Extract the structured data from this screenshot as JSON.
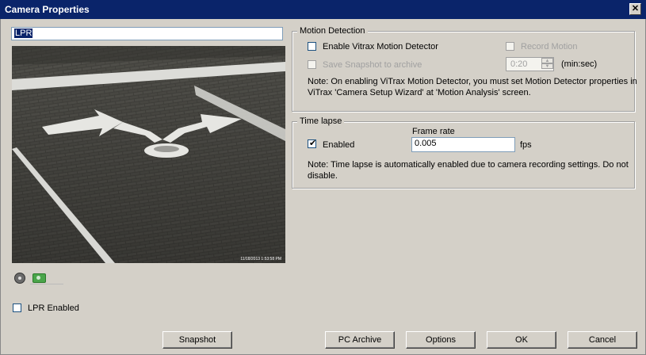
{
  "window": {
    "title": "Camera Properties",
    "close_glyph": "✕"
  },
  "camera_name": "LPR",
  "preview": {
    "timestamp": "11/18/2013 1:53:58 PM"
  },
  "lpr_enabled": {
    "label": "LPR Enabled",
    "checked": false
  },
  "motion": {
    "title": "Motion Detection",
    "enable_label": "Enable Vitrax Motion Detector",
    "record_label": "Record Motion",
    "snapshot_label": "Save Snapshot to archive",
    "duration_value": "0:20",
    "duration_unit": "(min:sec)",
    "note_line1": "Note: On enabling ViTrax Motion Detector, you must set Motion Detector properties in",
    "note_line2": "ViTrax 'Camera Setup Wizard' at 'Motion Analysis' screen."
  },
  "timelapse": {
    "title": "Time lapse",
    "enabled_label": "Enabled",
    "enabled_checked": true,
    "frame_rate_label": "Frame rate",
    "frame_rate_value": "0.005",
    "frame_rate_unit": "fps",
    "note_line1": "Note: Time lapse is automatically enabled due to camera recording settings. Do not",
    "note_line2": "disable."
  },
  "buttons": {
    "snapshot": "Snapshot",
    "pc_archive": "PC Archive",
    "options": "Options",
    "ok": "OK",
    "cancel": "Cancel"
  },
  "icons": [
    "camera-record-icon",
    "camera-snapshot-icon",
    "close-icon"
  ]
}
